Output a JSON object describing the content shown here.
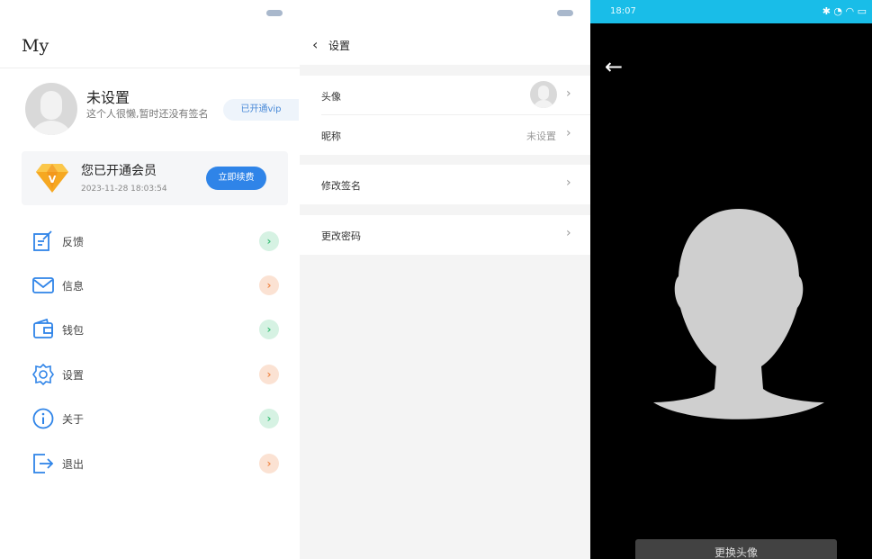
{
  "profile_page": {
    "title": "My",
    "user_name": "未设置",
    "signature": "这个人很懒,暂时还没有签名",
    "vip_badge": "已开通vip",
    "member": {
      "title": "您已开通会员",
      "date": "2023-11-28 18:03:54",
      "button": "立即续费"
    },
    "menu": [
      {
        "label": "反馈",
        "icon": "edit-icon",
        "arrow_color": "green"
      },
      {
        "label": "信息",
        "icon": "mail-icon",
        "arrow_color": "orange"
      },
      {
        "label": "钱包",
        "icon": "wallet-icon",
        "arrow_color": "green"
      },
      {
        "label": "设置",
        "icon": "gear-icon",
        "arrow_color": "orange"
      },
      {
        "label": "关于",
        "icon": "info-icon",
        "arrow_color": "green"
      },
      {
        "label": "退出",
        "icon": "logout-icon",
        "arrow_color": "orange"
      }
    ]
  },
  "settings_page": {
    "title": "设置",
    "rows": {
      "avatar": {
        "label": "头像"
      },
      "nickname": {
        "label": "昵称",
        "value": "未设置"
      },
      "signature": {
        "label": "修改签名"
      },
      "password": {
        "label": "更改密码"
      }
    }
  },
  "avatar_page": {
    "status_time": "18:07",
    "change_button": "更换头像"
  },
  "colors": {
    "accent_blue": "#2f84e8",
    "status_bar": "#19bde8",
    "arrow_green": "#3cbf78",
    "arrow_orange": "#f08a4b"
  }
}
